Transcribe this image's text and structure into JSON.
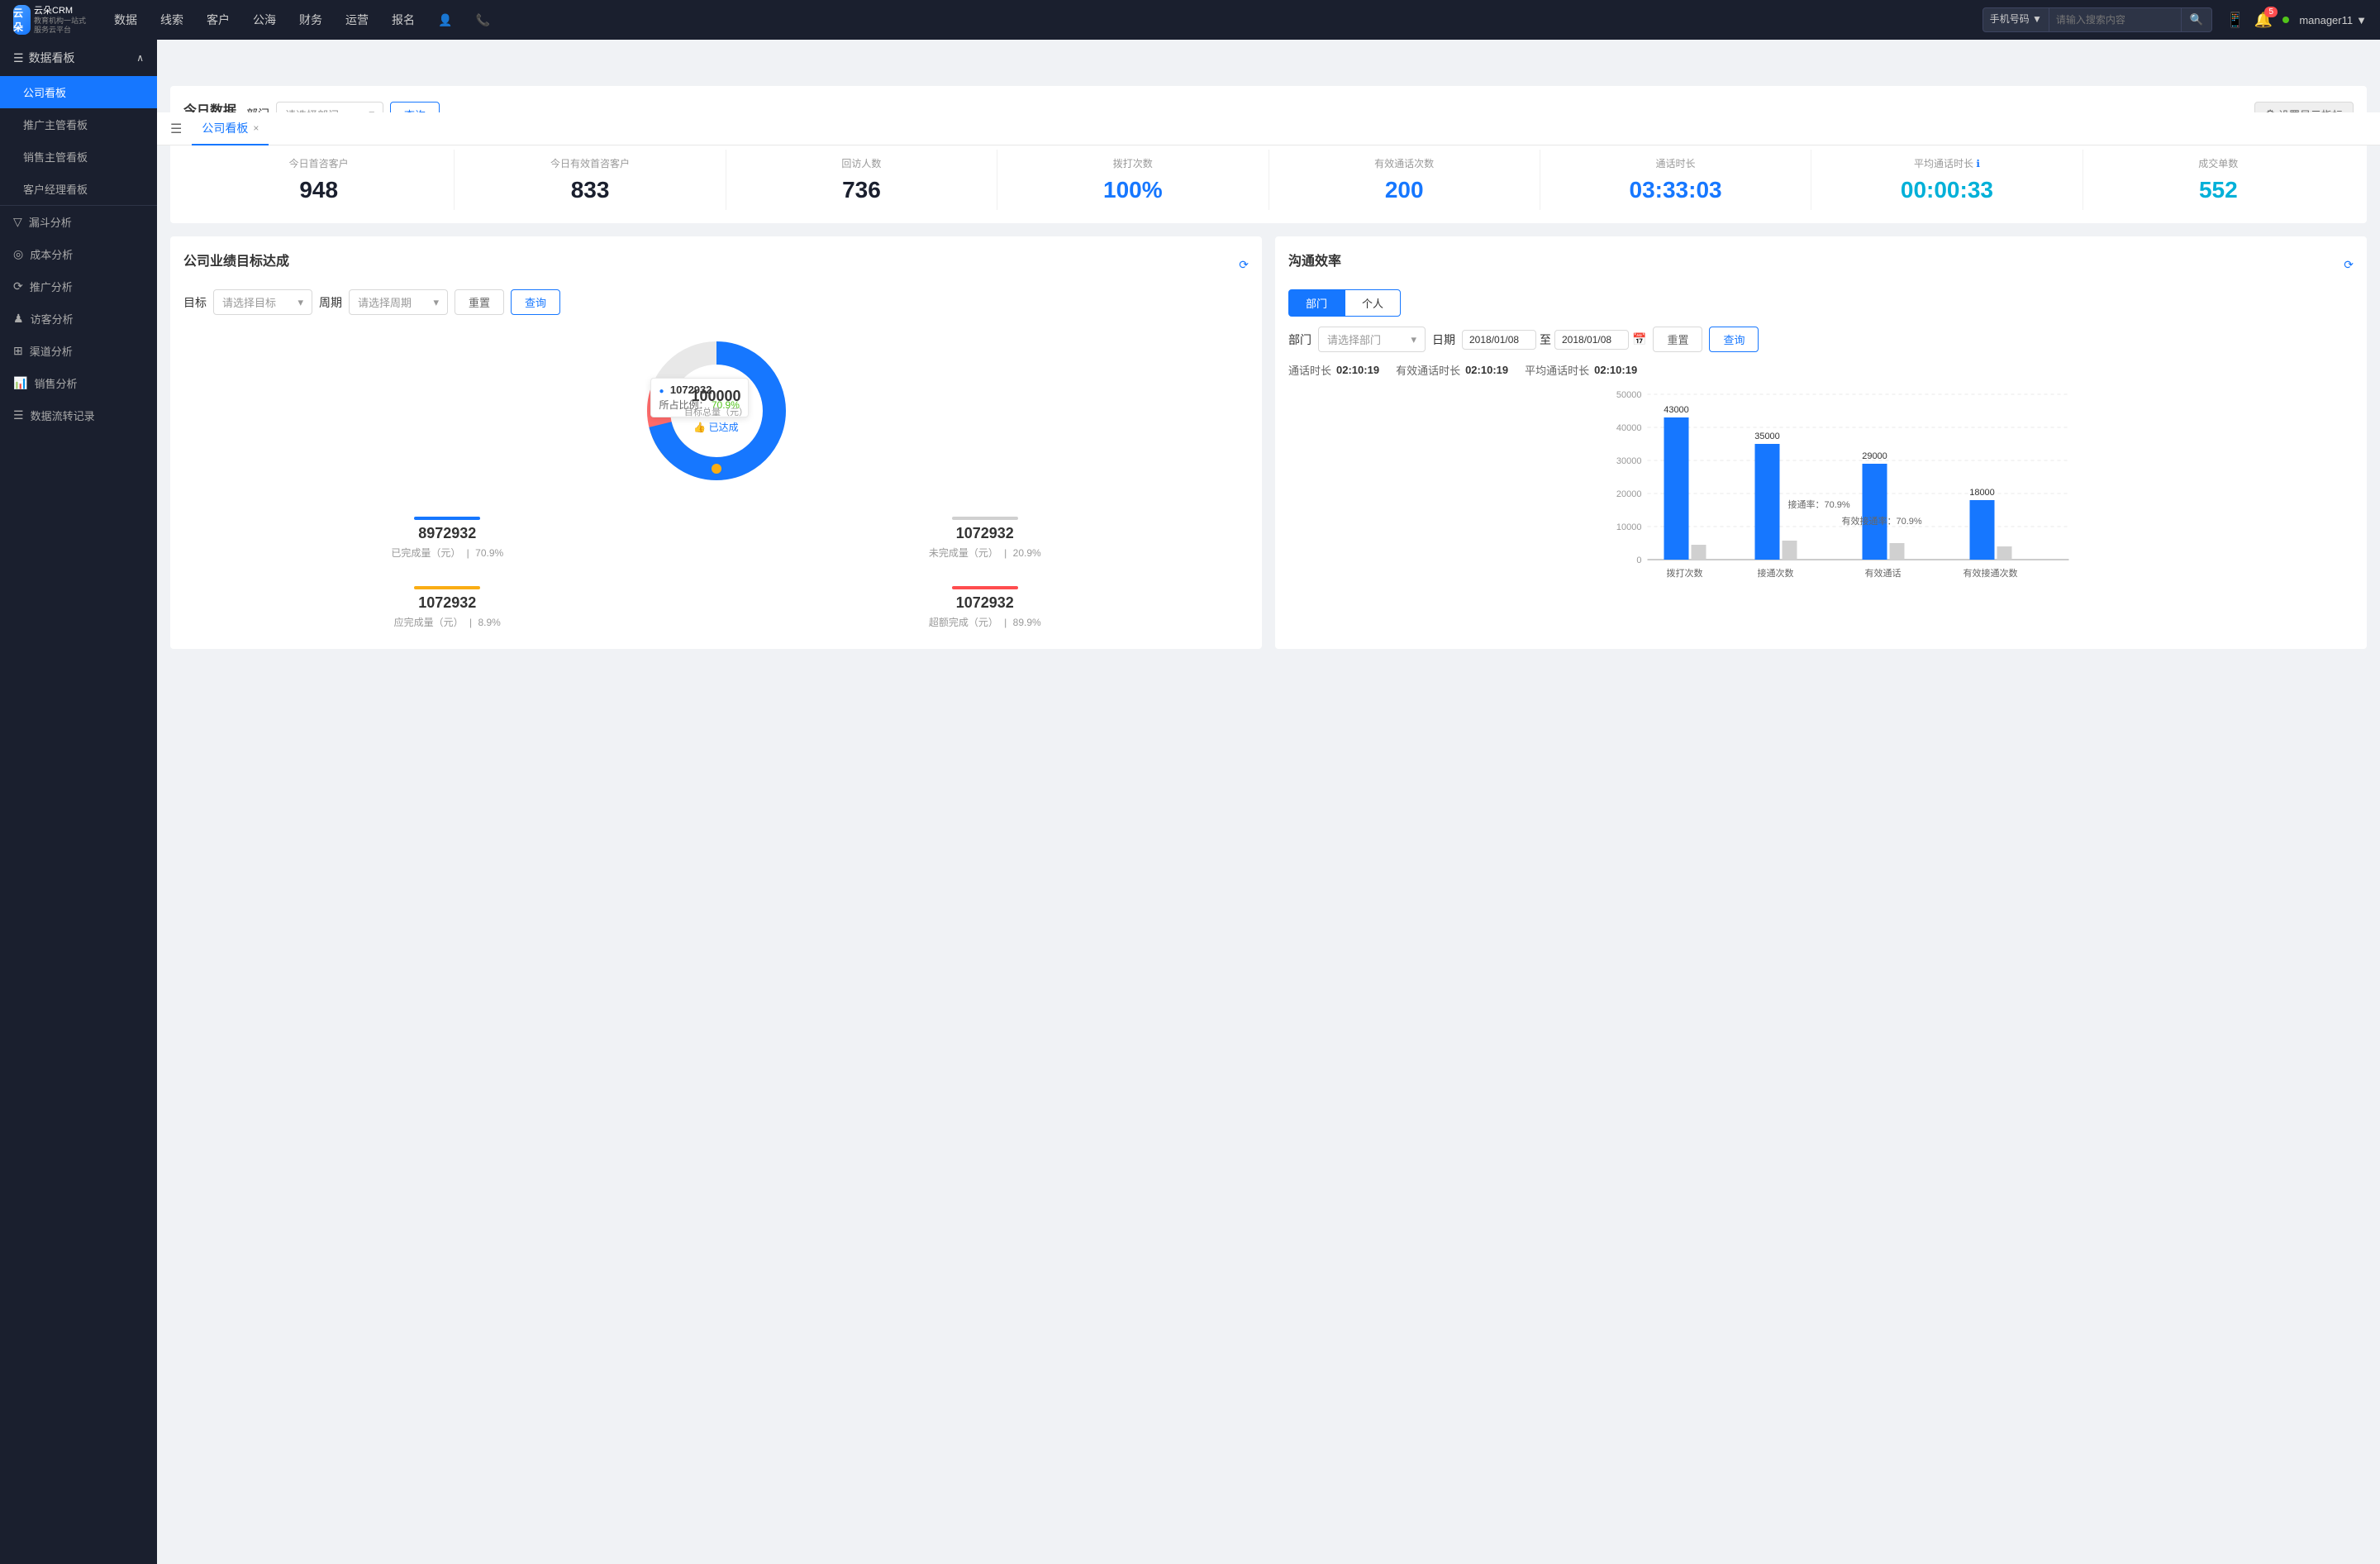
{
  "app": {
    "name": "云朵CRM",
    "subtitle": "教育机构一站\n让服务云平台"
  },
  "topNav": {
    "items": [
      "数据",
      "线索",
      "客户",
      "公海",
      "财务",
      "运营",
      "报名"
    ],
    "searchPlaceholder": "请输入搜索内容",
    "searchType": "手机号码",
    "notificationCount": "5",
    "username": "manager11"
  },
  "sidebar": {
    "sections": [
      {
        "title": "数据看板",
        "expanded": true,
        "items": [
          {
            "label": "公司看板",
            "active": true
          },
          {
            "label": "推广主管看板",
            "active": false
          },
          {
            "label": "销售主管看板",
            "active": false
          },
          {
            "label": "客户经理看板",
            "active": false
          }
        ]
      },
      {
        "title": "漏斗分析",
        "icon": "▽",
        "items": []
      },
      {
        "title": "成本分析",
        "icon": "◎",
        "items": []
      },
      {
        "title": "推广分析",
        "icon": "⟳",
        "items": []
      },
      {
        "title": "访客分析",
        "icon": "♟",
        "items": []
      },
      {
        "title": "渠道分析",
        "icon": "⊞",
        "items": []
      },
      {
        "title": "销售分析",
        "icon": "📊",
        "items": []
      },
      {
        "title": "数据流转记录",
        "icon": "☰",
        "items": []
      }
    ]
  },
  "tabs": [
    {
      "label": "公司看板",
      "active": true,
      "closable": true
    }
  ],
  "todayData": {
    "title": "今日数据",
    "deptLabel": "部门",
    "deptPlaceholder": "请选择部门",
    "queryBtn": "查询",
    "settingsBtn": "设置显示指标",
    "stats": [
      {
        "label": "今日首咨客户",
        "value": "948",
        "colorClass": "dark"
      },
      {
        "label": "今日有效首咨客户",
        "value": "833",
        "colorClass": "dark"
      },
      {
        "label": "回访人数",
        "value": "736",
        "colorClass": "dark"
      },
      {
        "label": "拨打次数",
        "value": "100%",
        "colorClass": "blue"
      },
      {
        "label": "有效通话次数",
        "value": "200",
        "colorClass": "blue"
      },
      {
        "label": "通话时长",
        "value": "03:33:03",
        "colorClass": "blue"
      },
      {
        "label": "平均通话时长",
        "value": "00:00:33",
        "colorClass": "cyan"
      },
      {
        "label": "成交单数",
        "value": "552",
        "colorClass": "cyan"
      }
    ]
  },
  "targetPanel": {
    "title": "公司业绩目标达成",
    "targetLabel": "目标",
    "targetPlaceholder": "请选择目标",
    "periodLabel": "周期",
    "periodPlaceholder": "请选择周期",
    "resetBtn": "重置",
    "queryBtn": "查询",
    "donut": {
      "centerValue": "100000",
      "centerLabel": "目标总量（元）",
      "centerBadge": "👍 已达成",
      "tooltip": {
        "value": "1072932",
        "pctLabel": "所占比例：",
        "pct": "70.9%"
      },
      "segments": [
        {
          "label": "已完成量（元）",
          "value": "8972932",
          "pct": "70.9%",
          "color": "#1677ff"
        },
        {
          "label": "未完成量（元）",
          "value": "1072932",
          "pct": "20.9%",
          "color": "#d0d0d0"
        },
        {
          "label": "应完成量（元）",
          "value": "1072932",
          "pct": "8.9%",
          "color": "#faad14"
        },
        {
          "label": "超额完成（元）",
          "value": "1072932",
          "pct": "89.9%",
          "color": "#ff4d4f"
        }
      ]
    }
  },
  "commPanel": {
    "title": "沟通效率",
    "tabs": [
      "部门",
      "个人"
    ],
    "activeTab": "部门",
    "deptLabel": "部门",
    "deptPlaceholder": "请选择部门",
    "dateLabel": "日期",
    "dateFrom": "2018/01/08",
    "dateTo": "2018/01/08",
    "resetBtn": "重置",
    "queryBtn": "查询",
    "summary": [
      {
        "label": "通话时长",
        "value": "02:10:19"
      },
      {
        "label": "有效通话时长",
        "value": "02:10:19"
      },
      {
        "label": "平均通话时长",
        "value": "02:10:19"
      }
    ],
    "chart": {
      "yMax": 50000,
      "yLabels": [
        "50000",
        "40000",
        "30000",
        "20000",
        "10000",
        "0"
      ],
      "bars": [
        {
          "groupLabel": "拨打次数",
          "bars": [
            {
              "value": 43000,
              "color": "#1677ff",
              "label": "43000"
            },
            {
              "value": 5000,
              "color": "#d0d0d0",
              "label": ""
            }
          ]
        },
        {
          "groupLabel": "接通次数",
          "bars": [
            {
              "value": 35000,
              "color": "#1677ff",
              "label": "35000"
            },
            {
              "value": 4000,
              "color": "#d0d0d0",
              "label": ""
            }
          ],
          "annotation": "接通率：70.9%"
        },
        {
          "groupLabel": "有效通话",
          "bars": [
            {
              "value": 29000,
              "color": "#1677ff",
              "label": "29000"
            },
            {
              "value": 3000,
              "color": "#d0d0d0",
              "label": ""
            }
          ],
          "annotation": "有效接通率：70.9%"
        },
        {
          "groupLabel": "有效接通次数",
          "bars": [
            {
              "value": 18000,
              "color": "#1677ff",
              "label": "18000"
            },
            {
              "value": 2000,
              "color": "#d0d0d0",
              "label": ""
            }
          ]
        }
      ]
    }
  }
}
